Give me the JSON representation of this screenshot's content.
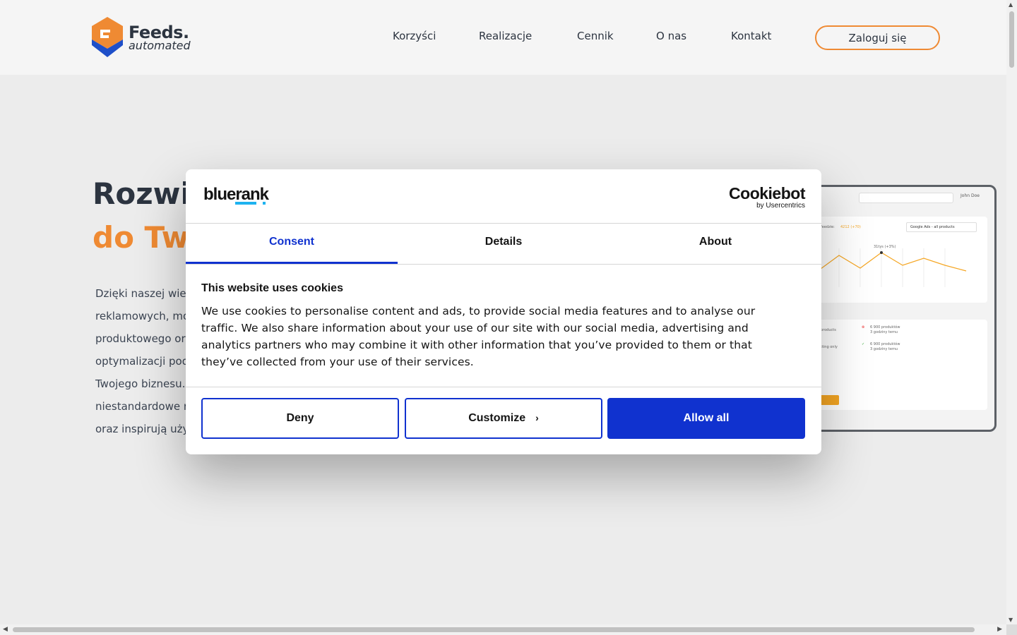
{
  "header": {
    "logo": {
      "word1": "Feeds.",
      "word2": "automated"
    },
    "nav": [
      {
        "label": "Korzyści"
      },
      {
        "label": "Realizacje"
      },
      {
        "label": "Cennik"
      },
      {
        "label": "O nas"
      },
      {
        "label": "Kontakt"
      }
    ],
    "login_label": "Zaloguj się"
  },
  "hero": {
    "title_line1": "Rozwi",
    "title_line2": "do Twe",
    "paragraph_lines": [
      "Dzięki naszej wied",
      "reklamowych, mo",
      "produktowego or",
      "optymalizacji pod",
      "Twojego biznesu.",
      "niestandardowe r",
      "oraz inspirują uży"
    ]
  },
  "mockup": {
    "user": "John Doe",
    "select": "Google Ads - all products",
    "feed_label": "feedzie:",
    "feed_value": "4212 (+70)",
    "peak_label": "31tys (+3%)",
    "row1_label": "products",
    "row1_value": "6 900 produktów",
    "row1_time": "3 godziny temu",
    "row2_label": "tting only",
    "row2_value": "6 900 produktów",
    "row2_time": "3 godziny temu",
    "section1": "ch"
  },
  "cookie_dialog": {
    "brand_logo": "bluerank",
    "provider_main": "Cookiebot",
    "provider_sub": "by Usercentrics",
    "tabs": [
      {
        "label": "Consent",
        "active": true
      },
      {
        "label": "Details",
        "active": false
      },
      {
        "label": "About",
        "active": false
      }
    ],
    "heading": "This website uses cookies",
    "body": "We use cookies to personalise content and ads, to provide social media features and to analyse our traffic. We also share information about your use of our site with our social media, advertising and analytics partners who may combine it with other information that you’ve provided to them or that they’ve collected from your use of their services.",
    "buttons": {
      "deny": "Deny",
      "customize": "Customize",
      "allow_all": "Allow all"
    },
    "accent_color": "#1032cf"
  },
  "colors": {
    "brand_orange": "#ef8a33",
    "brand_navy": "#2c3440",
    "brand_blue": "#1e4fc9"
  }
}
